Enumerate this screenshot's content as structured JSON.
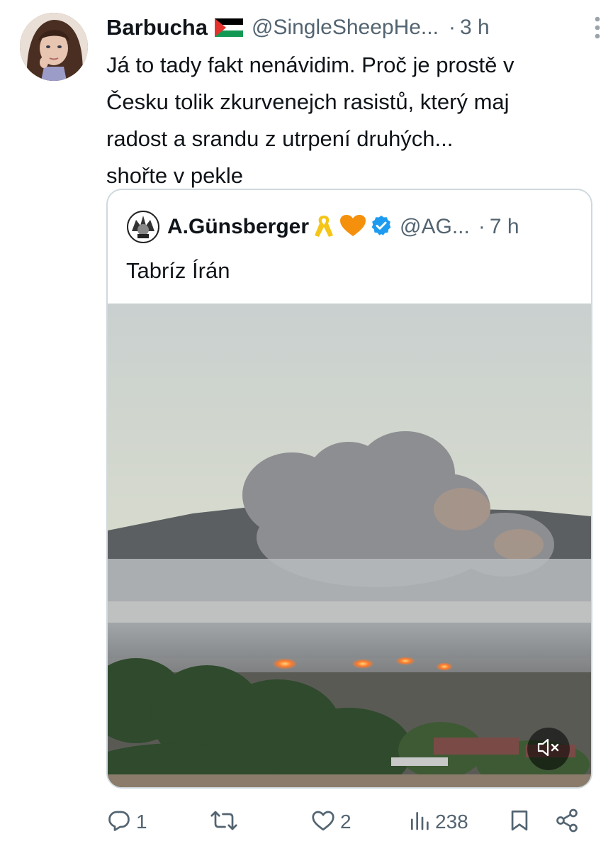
{
  "author": {
    "display_name": "Barbucha",
    "handle": "@SingleSheepHe...",
    "time_separator": "·",
    "time": "3 h",
    "flag_icon": "palestine-flag-icon"
  },
  "tweet_lines": [
    "Já to tady fakt nenávidim. Proč je prostě v",
    "Česku tolik zkurvenejch rasistů, který maj",
    "radost a srandu z utrpení druhých...",
    "shořte v pekle"
  ],
  "quote": {
    "display_name": "A.Günsberger",
    "handle": "@AG...",
    "time_separator": "·",
    "time": "7 h",
    "text": "Tabríz Írán",
    "icons": [
      "yellow-ribbon-icon",
      "orange-heart-icon",
      "verified-badge-icon"
    ],
    "media_controls": {
      "mute_icon": "speaker-muted-icon"
    }
  },
  "actions": {
    "replies": "1",
    "reposts": "",
    "likes": "2",
    "views": "238"
  },
  "colors": {
    "text": "#0f1419",
    "secondary": "#536471",
    "verified": "#1d9bf0",
    "border": "#cfd9de"
  }
}
